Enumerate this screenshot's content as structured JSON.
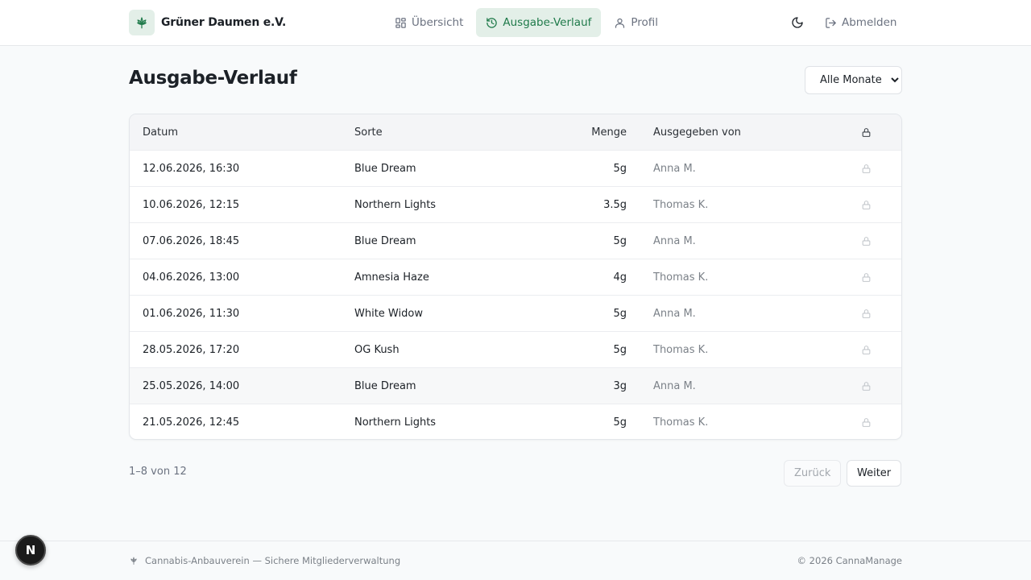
{
  "header": {
    "brand_name": "Grüner Daumen e.V.",
    "nav": [
      {
        "label": "Übersicht",
        "icon": "dashboard-grid-icon",
        "active": false
      },
      {
        "label": "Ausgabe-Verlauf",
        "icon": "history-icon",
        "active": true
      },
      {
        "label": "Profil",
        "icon": "user-icon",
        "active": false
      }
    ],
    "logout_label": "Abmelden"
  },
  "page": {
    "title": "Ausgabe-Verlauf",
    "month_filter": "Alle Monate"
  },
  "table": {
    "columns": {
      "date": "Datum",
      "strain": "Sorte",
      "amount": "Menge",
      "issued_by": "Ausgegeben von"
    },
    "rows": [
      {
        "date": "12.06.2026, 16:30",
        "strain": "Blue Dream",
        "amount": "5g",
        "issued_by": "Anna M."
      },
      {
        "date": "10.06.2026, 12:15",
        "strain": "Northern Lights",
        "amount": "3.5g",
        "issued_by": "Thomas K."
      },
      {
        "date": "07.06.2026, 18:45",
        "strain": "Blue Dream",
        "amount": "5g",
        "issued_by": "Anna M."
      },
      {
        "date": "04.06.2026, 13:00",
        "strain": "Amnesia Haze",
        "amount": "4g",
        "issued_by": "Thomas K."
      },
      {
        "date": "01.06.2026, 11:30",
        "strain": "White Widow",
        "amount": "5g",
        "issued_by": "Anna M."
      },
      {
        "date": "28.05.2026, 17:20",
        "strain": "OG Kush",
        "amount": "5g",
        "issued_by": "Thomas K."
      },
      {
        "date": "25.05.2026, 14:00",
        "strain": "Blue Dream",
        "amount": "3g",
        "issued_by": "Anna M."
      },
      {
        "date": "21.05.2026, 12:45",
        "strain": "Northern Lights",
        "amount": "5g",
        "issued_by": "Thomas K."
      }
    ]
  },
  "pagination": {
    "info": "1–8 von 12",
    "prev_label": "Zurück",
    "next_label": "Weiter"
  },
  "footer": {
    "tagline": "Cannabis-Anbauverein — Sichere Mitgliederverwaltung",
    "copyright": "© 2026 CannaManage"
  },
  "dev_badge": "N",
  "colors": {
    "accent": "#1f7a4a",
    "accent_bg": "#e3efe8",
    "muted_text": "#6b7280"
  }
}
